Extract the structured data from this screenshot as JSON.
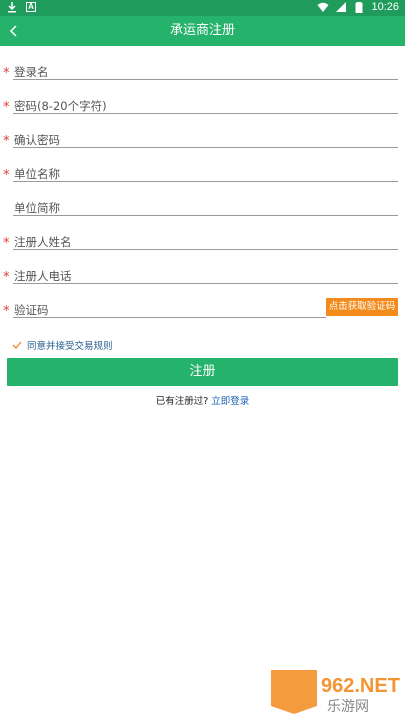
{
  "status_bar": {
    "time": "10:26"
  },
  "header": {
    "title": "承运商注册"
  },
  "fields": [
    {
      "label": "登录名",
      "required": true
    },
    {
      "label": "密码(8-20个字符)",
      "required": true
    },
    {
      "label": "确认密码",
      "required": true
    },
    {
      "label": "单位名称",
      "required": true
    },
    {
      "label": "单位简称",
      "required": false
    },
    {
      "label": "注册人姓名",
      "required": true
    },
    {
      "label": "注册人电话",
      "required": true
    },
    {
      "label": "验证码",
      "required": true
    }
  ],
  "required_mark": "*",
  "code_button": "点击获取验证码",
  "agree": {
    "text": "同意并接受交易规则",
    "checked": true
  },
  "submit_label": "注册",
  "login_prompt": "已有注册过?",
  "login_link": "立即登录",
  "watermark": {
    "brand": "962.NET",
    "sub": "乐游网"
  },
  "colors": {
    "primary": "#25b26a",
    "statusbar": "#1f9b5c",
    "accent": "#f28a1c",
    "required": "#e23a3a",
    "link": "#1a63b5"
  }
}
